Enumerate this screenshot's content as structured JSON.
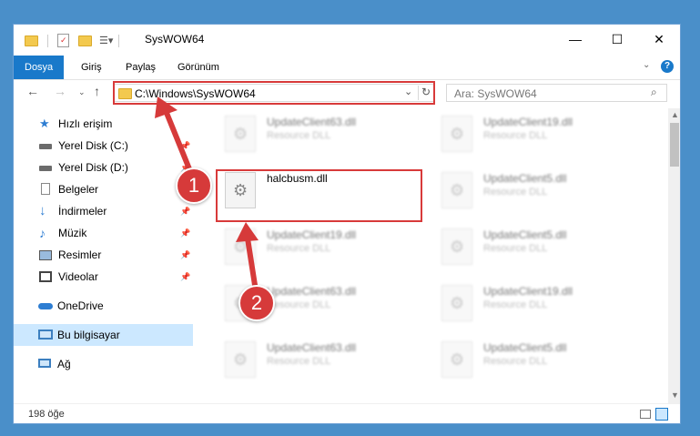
{
  "window": {
    "title": "SysWOW64",
    "controls": {
      "minimize": "—",
      "maximize": "☐",
      "close": "✕"
    }
  },
  "ribbon": {
    "tabs": [
      "Dosya",
      "Giriş",
      "Paylaş",
      "Görünüm"
    ],
    "active_tab": "Dosya",
    "accent": "#1979ca"
  },
  "address": {
    "path": "C:\\Windows\\SysWOW64",
    "search_placeholder": "Ara: SysWOW64"
  },
  "sidebar": {
    "items": [
      {
        "label": "Hızlı erişim",
        "icon": "star-icon"
      },
      {
        "label": "Yerel Disk (C:)",
        "icon": "drive-icon"
      },
      {
        "label": "Yerel Disk (D:)",
        "icon": "drive-icon"
      },
      {
        "label": "Belgeler",
        "icon": "document-icon"
      },
      {
        "label": "İndirmeler",
        "icon": "download-icon"
      },
      {
        "label": "Müzik",
        "icon": "music-icon"
      },
      {
        "label": "Resimler",
        "icon": "pictures-icon"
      },
      {
        "label": "Videolar",
        "icon": "video-icon"
      },
      {
        "label": "OneDrive",
        "icon": "cloud-icon"
      },
      {
        "label": "Bu bilgisayar",
        "icon": "computer-icon"
      },
      {
        "label": "Ağ",
        "icon": "network-icon"
      }
    ],
    "selected": "Bu bilgisayar"
  },
  "files": {
    "highlighted": {
      "name": "halcbusm.dll",
      "desc": ""
    },
    "left_column": [
      {
        "name": "UpdateClient63.dll",
        "desc": "Resource DLL"
      },
      {
        "name": "UpdateClient19.dll",
        "desc": "Resource DLL"
      },
      {
        "name": "UpdateClient63.dll",
        "desc": "Resource DLL"
      },
      {
        "name": "UpdateClient63.dll",
        "desc": "Resource DLL"
      }
    ],
    "right_column": [
      {
        "name": "UpdateClient19.dll",
        "desc": "Resource DLL"
      },
      {
        "name": "UpdateClient5.dll",
        "desc": "Resource DLL"
      },
      {
        "name": "UpdateClient5.dll",
        "desc": "Resource DLL"
      },
      {
        "name": "UpdateClient19.dll",
        "desc": "Resource DLL"
      },
      {
        "name": "UpdateClient5.dll",
        "desc": "Resource DLL"
      }
    ]
  },
  "status": {
    "count": "198 öğe"
  },
  "annotations": {
    "step1": "1",
    "step2": "2",
    "color": "#d63a3a"
  }
}
